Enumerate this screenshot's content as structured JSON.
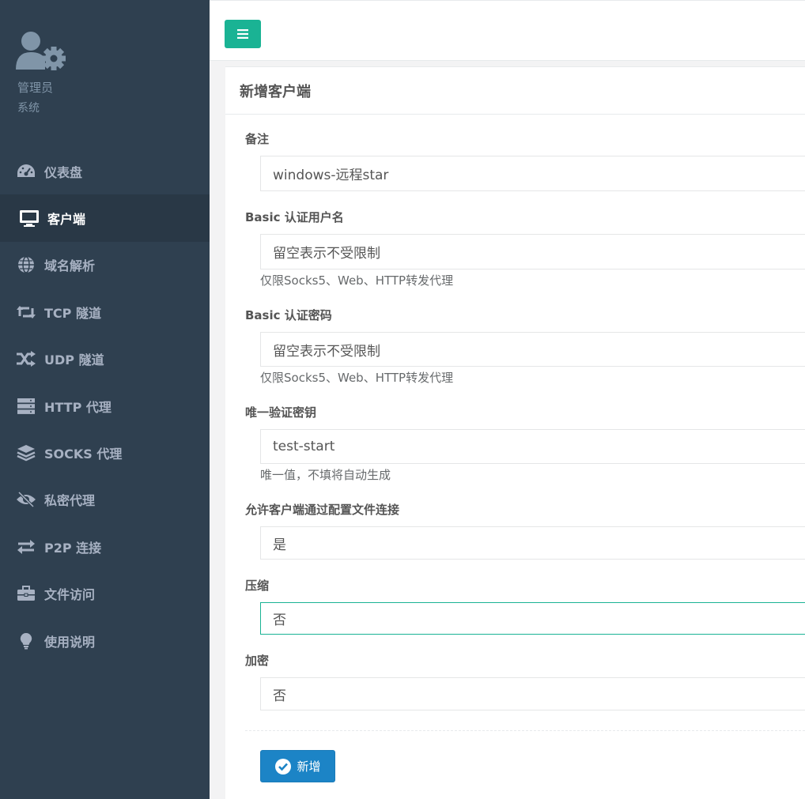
{
  "profile": {
    "role": "管理员",
    "subtitle": "系统"
  },
  "nav": [
    {
      "icon": "dashboard-icon",
      "label": "仪表盘",
      "active": false
    },
    {
      "icon": "monitor-icon",
      "label": "客户端",
      "active": true
    },
    {
      "icon": "globe-icon",
      "label": "域名解析",
      "active": false
    },
    {
      "icon": "retweet-icon",
      "label": "TCP 隧道",
      "active": false
    },
    {
      "icon": "shuffle-icon",
      "label": "UDP 隧道",
      "active": false
    },
    {
      "icon": "server-icon",
      "label": "HTTP 代理",
      "active": false
    },
    {
      "icon": "layers-icon",
      "label": "SOCKS 代理",
      "active": false
    },
    {
      "icon": "eye-slash-icon",
      "label": "私密代理",
      "active": false
    },
    {
      "icon": "exchange-icon",
      "label": "P2P 连接",
      "active": false
    },
    {
      "icon": "briefcase-icon",
      "label": "文件访问",
      "active": false
    },
    {
      "icon": "lightbulb-icon",
      "label": "使用说明",
      "active": false
    }
  ],
  "panel": {
    "title": "新增客户端",
    "fields": {
      "remark": {
        "label": "备注",
        "value": "windows-远程star"
      },
      "basic_user": {
        "label": "Basic 认证用户名",
        "placeholder": "留空表示不受限制",
        "help": "仅限Socks5、Web、HTTP转发代理"
      },
      "basic_pass": {
        "label": "Basic 认证密码",
        "placeholder": "留空表示不受限制",
        "help": "仅限Socks5、Web、HTTP转发代理"
      },
      "vkey": {
        "label": "唯一验证密钥",
        "value": "test-start",
        "help": "唯一值，不填将自动生成"
      },
      "config_conn": {
        "label": "允许客户端通过配置文件连接",
        "value": "是"
      },
      "compress": {
        "label": "压缩",
        "value": "否"
      },
      "crypt": {
        "label": "加密",
        "value": "否"
      }
    },
    "submit_label": "新增"
  },
  "colors": {
    "sidebar": "#2f4050",
    "accent": "#1ab394",
    "primary": "#1c84c6"
  }
}
